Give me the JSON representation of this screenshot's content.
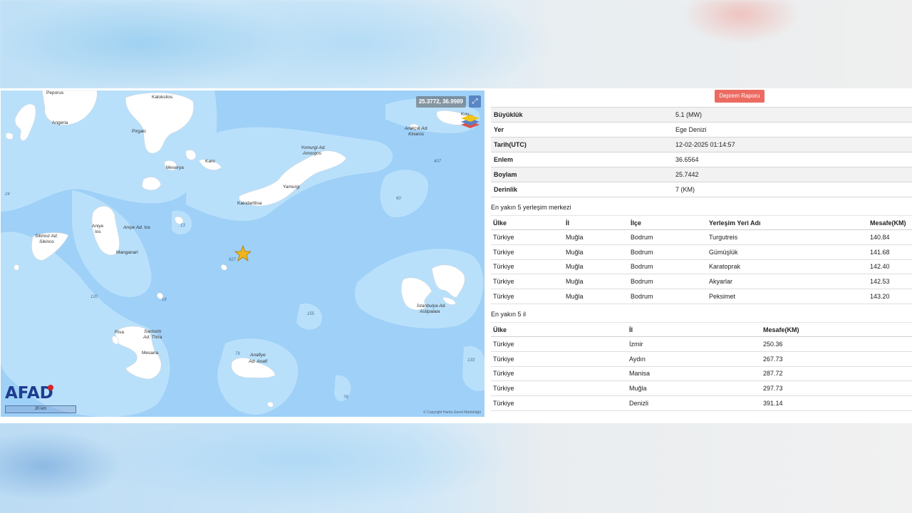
{
  "map": {
    "coordinates": "25.3772, 36.9989",
    "logo": "AFAD",
    "scale": "20 km",
    "attribution": "© Copyright Harita Genel Müdürlüğü",
    "labels": {
      "kaloksilos": "Kaloksilos",
      "angeria": "Angeria",
      "pirgaki": "Pirgaki",
      "mesarya": "Meserya",
      "karo": "Karo",
      "yomurgi": "Yomurgi Ad.",
      "amorgos": "Amorgos",
      "yamurgi": "Yamurgi",
      "kalodarttisa": "Kalodarttisa",
      "sikinoz": "Sikinoz Ad.",
      "sikinos": "Sikinos",
      "aniye": "Aniye",
      "ios": "Ios",
      "aniyeAd": "Aniye Ad. Ios",
      "manganari": "Manganari",
      "riva": "Riva",
      "santurin": "Santurin",
      "thira": "Ad. Thira",
      "mesaria": "Mesaria",
      "arakcik": "Arakçık Ad.",
      "kinaros": "Kinaros",
      "istanbulya": "İstanbulya Ad.",
      "astipalaia": "Astipalaia",
      "anafiye": "Anafiye",
      "anafi": "Ad. Anafi",
      "koufonisi": "Kou...",
      "peporus": "Peporus"
    },
    "depths": [
      "24",
      "13",
      "627",
      "60",
      "407",
      "120",
      "18",
      "155",
      "79",
      "133",
      "78"
    ]
  },
  "report_button": "Deprem Raporu",
  "info": [
    {
      "key": "Büyüklük",
      "value": "5.1 (MW)"
    },
    {
      "key": "Yer",
      "value": "Ege Denizi"
    },
    {
      "key": "Tarih(UTC)",
      "value": "12-02-2025 01:14:57"
    },
    {
      "key": "Enlem",
      "value": "36.6564"
    },
    {
      "key": "Boylam",
      "value": "25.7442"
    },
    {
      "key": "Derinlik",
      "value": "7 (KM)"
    }
  ],
  "settlements": {
    "title": "En yakın 5 yerleşim merkezi",
    "headers": [
      "Ülke",
      "İl",
      "İlçe",
      "Yerleşim Yeri Adı",
      "Mesafe(KM)"
    ],
    "rows": [
      [
        "Türkiye",
        "Muğla",
        "Bodrum",
        "Turgutreis",
        "140.84"
      ],
      [
        "Türkiye",
        "Muğla",
        "Bodrum",
        "Gümüşlük",
        "141.68"
      ],
      [
        "Türkiye",
        "Muğla",
        "Bodrum",
        "Karatoprak",
        "142.40"
      ],
      [
        "Türkiye",
        "Muğla",
        "Bodrum",
        "Akyarlar",
        "142.53"
      ],
      [
        "Türkiye",
        "Muğla",
        "Bodrum",
        "Peksimet",
        "143.20"
      ]
    ]
  },
  "provinces": {
    "title": "En yakın 5 il",
    "headers": [
      "Ülke",
      "İl",
      "Mesafe(KM)"
    ],
    "rows": [
      [
        "Türkiye",
        "İzmir",
        "250.36"
      ],
      [
        "Türkiye",
        "Aydın",
        "267.73"
      ],
      [
        "Türkiye",
        "Manisa",
        "287.72"
      ],
      [
        "Türkiye",
        "Muğla",
        "297.73"
      ],
      [
        "Türkiye",
        "Denizli",
        "391.14"
      ]
    ]
  }
}
